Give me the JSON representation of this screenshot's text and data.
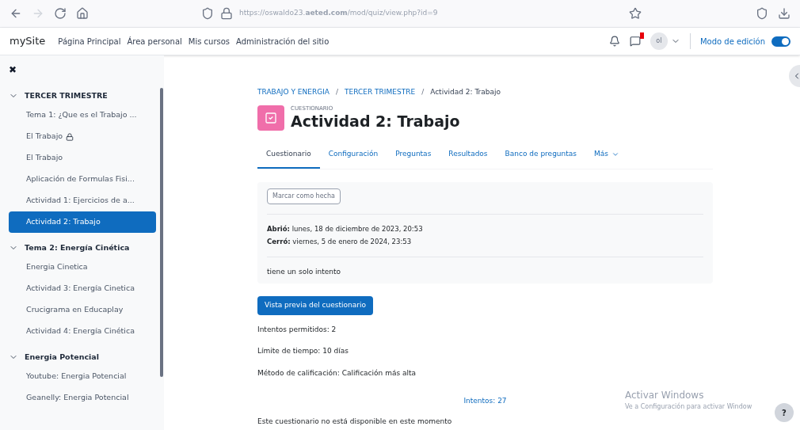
{
  "browser": {
    "url": "https://oswaldo23.**aeted.com**/mod/quiz/view.php?id=9"
  },
  "navbar": {
    "site": "mySite",
    "links": [
      {
        "label": "Página Principal"
      },
      {
        "label": "Área personal"
      },
      {
        "label": "Mis cursos"
      },
      {
        "label": "Administración del sitio"
      }
    ],
    "avatar": "ol",
    "edit_mode": {
      "label": "Modo de edición",
      "on": true
    }
  },
  "sidebar": {
    "close": "✖",
    "sections": [
      {
        "title": "TERCER TRIMESTRE",
        "expanded": true,
        "items": [
          {
            "label": "Tema 1: ¿Que es el Trabajo ...",
            "selected": false,
            "locked": false
          },
          {
            "label": "El Trabajo",
            "selected": false,
            "locked": true
          },
          {
            "label": "El Trabajo",
            "selected": false,
            "locked": false
          },
          {
            "label": "Aplicación de Formulas Fisi...",
            "selected": false,
            "locked": false
          },
          {
            "label": "Actividad 1: Ejercicios de a...",
            "selected": false,
            "locked": false
          },
          {
            "label": "Actividad 2: Trabajo",
            "selected": true,
            "locked": false
          }
        ]
      },
      {
        "title": "Tema 2: Energía Cinética",
        "expanded": true,
        "items": [
          {
            "label": "Energia Cinetica",
            "selected": false,
            "locked": false
          },
          {
            "label": "Actividad 3: Energía Cinetica",
            "selected": false,
            "locked": false
          },
          {
            "label": "Crucigrama en Educaplay",
            "selected": false,
            "locked": false
          },
          {
            "label": "Actividad 4: Energía Cinética",
            "selected": false,
            "locked": false
          }
        ]
      },
      {
        "title": "Energia Potencial",
        "expanded": true,
        "items": [
          {
            "label": "Youtube: Energia Potencial",
            "selected": false,
            "locked": false
          },
          {
            "label": "Geanelly: Energia Potencial",
            "selected": false,
            "locked": false
          }
        ]
      }
    ]
  },
  "breadcrumb": [
    {
      "kind": "link",
      "label": "TRABAJO Y ENERGIA"
    },
    {
      "kind": "separator",
      "label": "/"
    },
    {
      "kind": "link",
      "label": "TERCER TRIMESTRE"
    },
    {
      "kind": "separator",
      "label": "/"
    },
    {
      "kind": "current",
      "label": "Actividad 2: Trabajo"
    }
  ],
  "header": {
    "type": "CUESTIONARIO",
    "title": "Actividad 2: Trabajo"
  },
  "tabs": [
    {
      "label": "Cuestionario",
      "selected": true
    },
    {
      "label": "Configuración",
      "selected": false
    },
    {
      "label": "Preguntas",
      "selected": false
    },
    {
      "label": "Resultados",
      "selected": false
    },
    {
      "label": "Banco de preguntas",
      "selected": false
    },
    {
      "label": "Más",
      "selected": false
    }
  ],
  "info": {
    "mark_button": "Marcar como hecha",
    "dates": [
      "**Abrió:** lunes, 18 de diciembre de 2023, 20:53",
      "**Cerró:** viernes, 5 de enero de 2024, 23:53"
    ],
    "description": "tiene un solo intento"
  },
  "preview_button": "Vista previa del cuestionario",
  "details": [
    "Intentos permitidos: 2",
    "Límite de tiempo: 10 días",
    "Método de calificación: Calificación más alta"
  ],
  "attempts_link": "Intentos: 27",
  "notice": "Este cuestionario no está disponible en este momento",
  "os_notice": {
    "title": "Activar Windows",
    "text": "Ve a Configuración para activar Window"
  },
  "help": "?"
}
